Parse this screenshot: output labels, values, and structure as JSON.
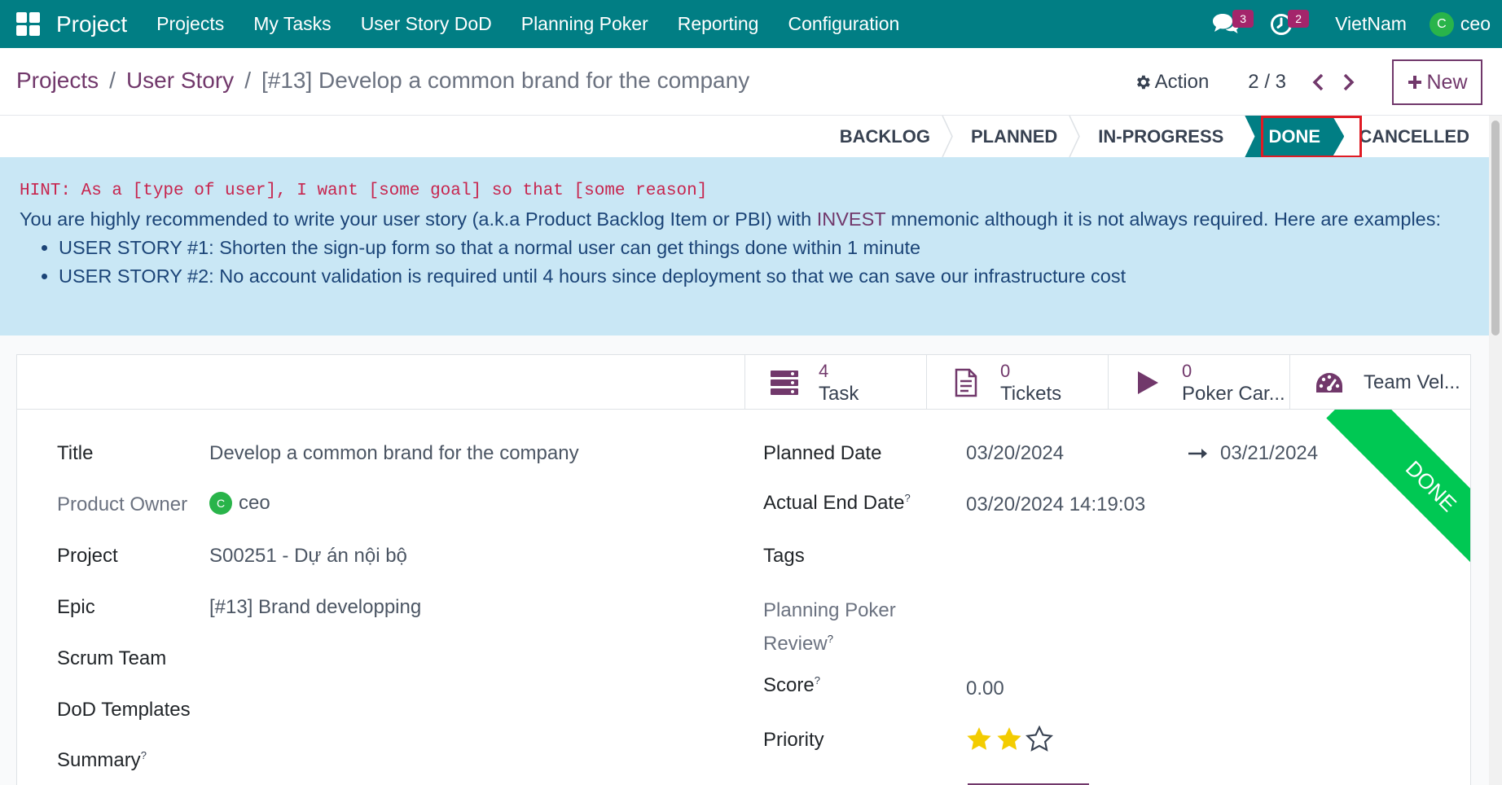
{
  "navbar": {
    "app_name": "Project",
    "menu": [
      "Projects",
      "My Tasks",
      "User Story DoD",
      "Planning Poker",
      "Reporting",
      "Configuration"
    ],
    "messages_count": "3",
    "activities_count": "2",
    "company": "VietNam",
    "user_initial": "C",
    "user_name": "ceo"
  },
  "breadcrumb": {
    "projects": "Projects",
    "user_story": "User Story",
    "current": "[#13] Develop a common brand for the company",
    "sep": "/"
  },
  "control": {
    "action_label": "Action",
    "pager": "2 / 3",
    "new_label": "New"
  },
  "stages": {
    "backlog": "BACKLOG",
    "planned": "PLANNED",
    "in_progress": "IN-PROGRESS",
    "done": "DONE",
    "cancelled": "CANCELLED",
    "active": "DONE"
  },
  "hint": {
    "code": "HINT: As a [type of user], I want [some goal] so that [some reason]",
    "line_before": "You are highly recommended to write your user story (a.k.a Product Backlog Item or PBI) with ",
    "invest": "INVEST",
    "line_after": " mnemonic although it is not always required. Here are examples:",
    "examples": [
      "USER STORY #1: Shorten the sign-up form so that a normal user can get things done within 1 minute",
      "USER STORY #2: No account validation is required until 4 hours since deployment so that we can save our infrastructure cost"
    ]
  },
  "stat_buttons": {
    "task": {
      "count": "4",
      "label": "Task"
    },
    "tickets": {
      "count": "0",
      "label": "Tickets"
    },
    "poker": {
      "count": "0",
      "label": "Poker Car..."
    },
    "velocity": {
      "label": "Team Vel..."
    }
  },
  "ribbon": "DONE",
  "form": {
    "title_label": "Title",
    "title_value": "Develop a common brand for the company",
    "owner_label": "Product Owner",
    "owner_initial": "C",
    "owner_value": "ceo",
    "project_label": "Project",
    "project_value": "S00251 - Dự án nội bộ",
    "epic_label": "Epic",
    "epic_value": "[#13] Brand developping",
    "scrum_label": "Scrum Team",
    "dod_label": "DoD Templates",
    "summary_label": "Summary",
    "planned_date_label": "Planned Date",
    "planned_start": "03/20/2024",
    "planned_end": "03/21/2024",
    "actual_end_label": "Actual End Date",
    "actual_end_value": "03/20/2024 14:19:03",
    "tags_label": "Tags",
    "poker_review_label_1": "Planning Poker",
    "poker_review_label_2": "Review",
    "score_label": "Score",
    "score_value": "0.00",
    "priority_label": "Priority",
    "priority_value": 2,
    "priority_max": 3,
    "help_mark": "?"
  },
  "colors": {
    "navbar": "#017e84",
    "accent": "#71386b",
    "stage_active": "#017e84",
    "ribbon": "#00c853",
    "hint_bg": "#c9e7f5",
    "star": "#f3cc00",
    "highlight": "#e01b24"
  }
}
